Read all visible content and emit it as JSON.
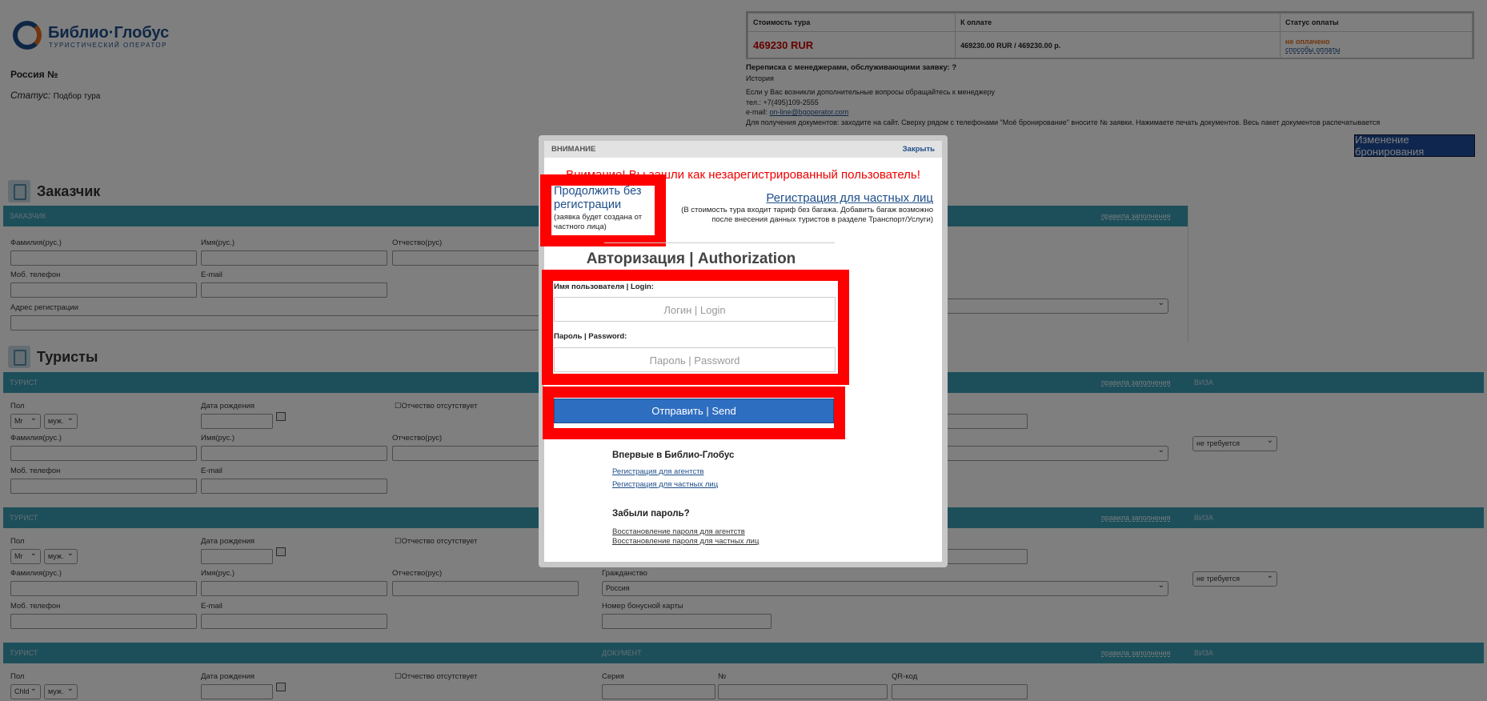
{
  "logo": {
    "name": "Библио·Глобус",
    "subtitle": "ТУРИСТИЧЕСКИЙ ОПЕРАТОР"
  },
  "header": {
    "country": "Россия №",
    "status_label": "Статус:",
    "status_value": "Подбор тура"
  },
  "price_table": {
    "headers": [
      "Стоимость тура",
      "К оплате",
      "Статус оплаты"
    ],
    "tour_cost": "469230 RUR",
    "to_pay": "469230.00 RUR / 469230.00 р.",
    "payment_status": "не оплачено",
    "payment_methods_link": "способы оплаты"
  },
  "info": {
    "correspondence": "Переписка с менеджерами, обслуживающими заявку: ?",
    "history": "История",
    "questions": "Если у Вас возникли дополнительные вопросы обращайтесь к менеджеру",
    "phone": "тел.: +7(495)109-2555",
    "email_label": "e-mail:",
    "email": "on-line@bgoperator.com",
    "docs": "Для получения документов: заходите на сайт. Сверху рядом с телефонами \"Моё бронирование\" вносите № заявки. Нажимаете печать документов. Весь пакет документов распечатывается"
  },
  "change_booking_button": "Изменение бронирования",
  "customer_section": {
    "title": "Заказчик",
    "bar_label": "ЗАКАЗЧИК",
    "rules_link": "правила заполнения",
    "fields": {
      "surname": "Фамилия(рус.)",
      "name": "Имя(рус.)",
      "patronymic": "Отчество(рус)",
      "mobile": "Моб. телефон",
      "email": "E-mail",
      "address": "Адрес регистрации"
    }
  },
  "tourists_section": {
    "title": "Туристы",
    "bar_label": "ТУРИСТ",
    "document_label": "ДОКУМЕНТ",
    "visa_label": "ВИЗА",
    "rules_link": "правила заполнения",
    "labels": {
      "gender": "Пол",
      "birth_date": "Дата рождения",
      "no_patronymic": "Отчество отсутствует",
      "surname": "Фамилия(рус.)",
      "name": "Имя(рус.)",
      "patronymic": "Отчество(рус)",
      "mobile": "Моб. телефон",
      "email": "E-mail",
      "citizenship": "Гражданство",
      "citizenship_value": "Россия",
      "bonus_card": "Номер бонусной карты",
      "series": "Серия",
      "number": "№",
      "qr_code": "QR-код",
      "visa_value": "не требуется"
    },
    "tourists": [
      {
        "title_value": "Mr",
        "gender_value": "муж."
      },
      {
        "title_value": "Mr",
        "gender_value": "муж."
      },
      {
        "title_value": "Chld",
        "gender_value": "муж."
      }
    ]
  },
  "modal": {
    "header_title": "ВНИМАНИЕ",
    "close_label": "Закрыть",
    "warning": "Внимание! Вы зашли как незарегистрированный пользователь!",
    "continue_link": "Продолжить без регистрации",
    "continue_note": "(заявка будет создана от частного лица)",
    "register_individual_link": "Регистрация для частных лиц",
    "register_note": "(В стоимость тура входит тариф без багажа. Добавить багаж возможно после внесения данных туристов в разделе Транспорт/Услуги)",
    "auth_title": "Авторизация | Authorization",
    "login_label": "Имя пользователя | Login:",
    "login_placeholder": "Логин | Login",
    "password_label": "Пароль | Password:",
    "password_placeholder": "Пароль | Password",
    "send_button": "Отправить | Send",
    "first_time_title": "Впервые в Библио-Глобус",
    "agency_registration": "Регистрация для агентств",
    "individual_registration": "Регистрация для частных лиц",
    "forgot_title": "Забыли пароль?",
    "recover_agency": "Восстановление пароля для агентств",
    "recover_individual": "Восстановление пароля для частных лиц"
  }
}
